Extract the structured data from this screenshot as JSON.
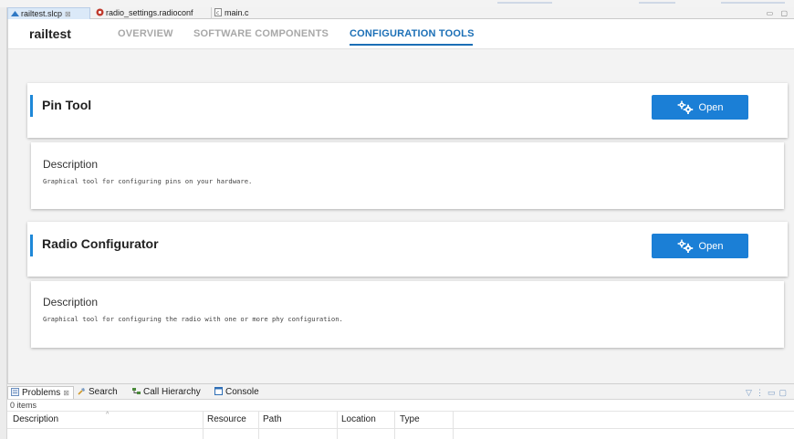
{
  "editor_tabs": [
    {
      "label": "railtest.slcp",
      "active": true,
      "icon": "slcp-project-icon"
    },
    {
      "label": "radio_settings.radioconf",
      "active": false,
      "icon": "radioconf-icon"
    },
    {
      "label": "main.c",
      "active": false,
      "icon": "c-file-icon"
    }
  ],
  "project": {
    "name": "railtest",
    "nav": [
      "OVERVIEW",
      "SOFTWARE COMPONENTS",
      "CONFIGURATION TOOLS"
    ],
    "active_nav": "CONFIGURATION TOOLS"
  },
  "tools": [
    {
      "title": "Pin Tool",
      "button": "Open",
      "description_label": "Description",
      "description": "Graphical tool for configuring pins on your hardware."
    },
    {
      "title": "Radio Configurator",
      "button": "Open",
      "description_label": "Description",
      "description": "Graphical tool for configuring the radio with one or more phy configuration."
    }
  ],
  "bottom_panel": {
    "tabs": [
      {
        "label": "Problems",
        "active": true,
        "icon": "problems-icon"
      },
      {
        "label": "Search",
        "active": false,
        "icon": "search-icon"
      },
      {
        "label": "Call Hierarchy",
        "active": false,
        "icon": "call-hierarchy-icon"
      },
      {
        "label": "Console",
        "active": false,
        "icon": "console-icon"
      }
    ],
    "item_count": "0 items",
    "columns": [
      "Description",
      "Resource",
      "Path",
      "Location",
      "Type"
    ]
  },
  "colors": {
    "accent": "#1e88d8",
    "button": "#1b7fd6",
    "active_nav": "#1b6fb6"
  }
}
